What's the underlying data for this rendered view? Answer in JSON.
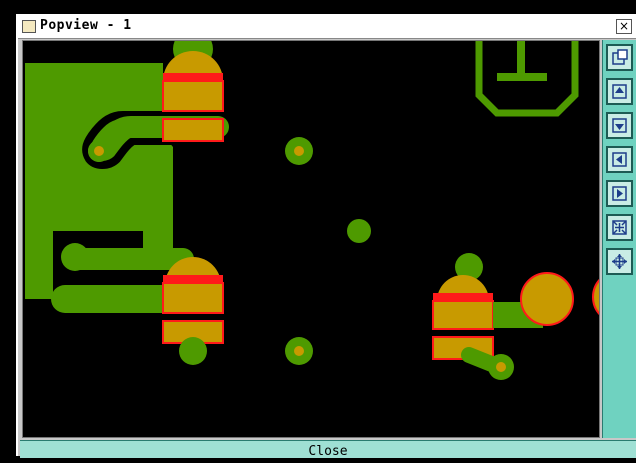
{
  "window": {
    "title": "Popview - 1",
    "close_glyph": "×",
    "close_button_label": "Close"
  },
  "toolbar": {
    "buttons": [
      {
        "name": "zoom-window-icon"
      },
      {
        "name": "pan-up-icon"
      },
      {
        "name": "pan-down-icon"
      },
      {
        "name": "pan-left-icon"
      },
      {
        "name": "pan-right-icon"
      },
      {
        "name": "zoom-fit-icon"
      },
      {
        "name": "zoom-in-icon"
      }
    ]
  },
  "colors": {
    "copper": "#4e9a00",
    "pad": "#c89a00",
    "pad_outline": "#ff1a1a",
    "canvas": "#000000",
    "toolbar": "#6fd2c0"
  }
}
